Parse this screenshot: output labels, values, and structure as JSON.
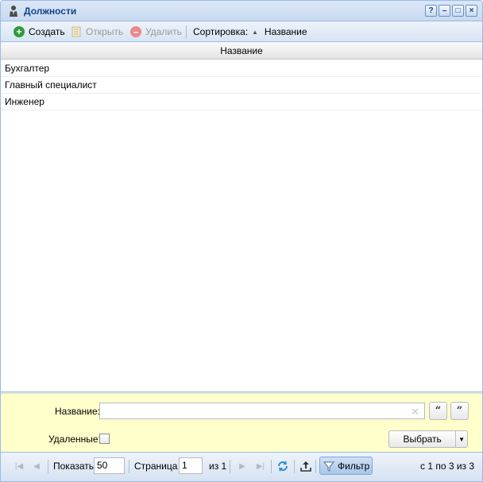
{
  "window": {
    "title": "Должности",
    "buttons": {
      "help": "?",
      "minimize": "–",
      "maximize": "□",
      "close": "×"
    }
  },
  "toolbar": {
    "create": "Создать",
    "open": "Открыть",
    "delete": "Удалить",
    "sort_label": "Сортировка:",
    "sort_field": "Название"
  },
  "grid": {
    "column": "Название",
    "rows": [
      "Бухгалтер",
      "Главный специалист",
      "Инженер"
    ]
  },
  "filter": {
    "name_label": "Название:",
    "name_value": "",
    "deleted_label": "Удаленные:",
    "deleted_checked": false,
    "select_button": "Выбрать"
  },
  "paging": {
    "show_label": "Показать",
    "page_size": "50",
    "page_label": "Страница",
    "page_value": "1",
    "of_label": "из 1",
    "filter_button": "Фильтр",
    "summary": "с 1 по 3 из 3"
  },
  "colors": {
    "title": "#15428b",
    "border": "#99bbe8",
    "filter_bg": "#ffffcc",
    "create_icon": "#2e9b3a",
    "delete_icon": "#e26a6a",
    "refresh_icon": "#2f8fd0"
  }
}
